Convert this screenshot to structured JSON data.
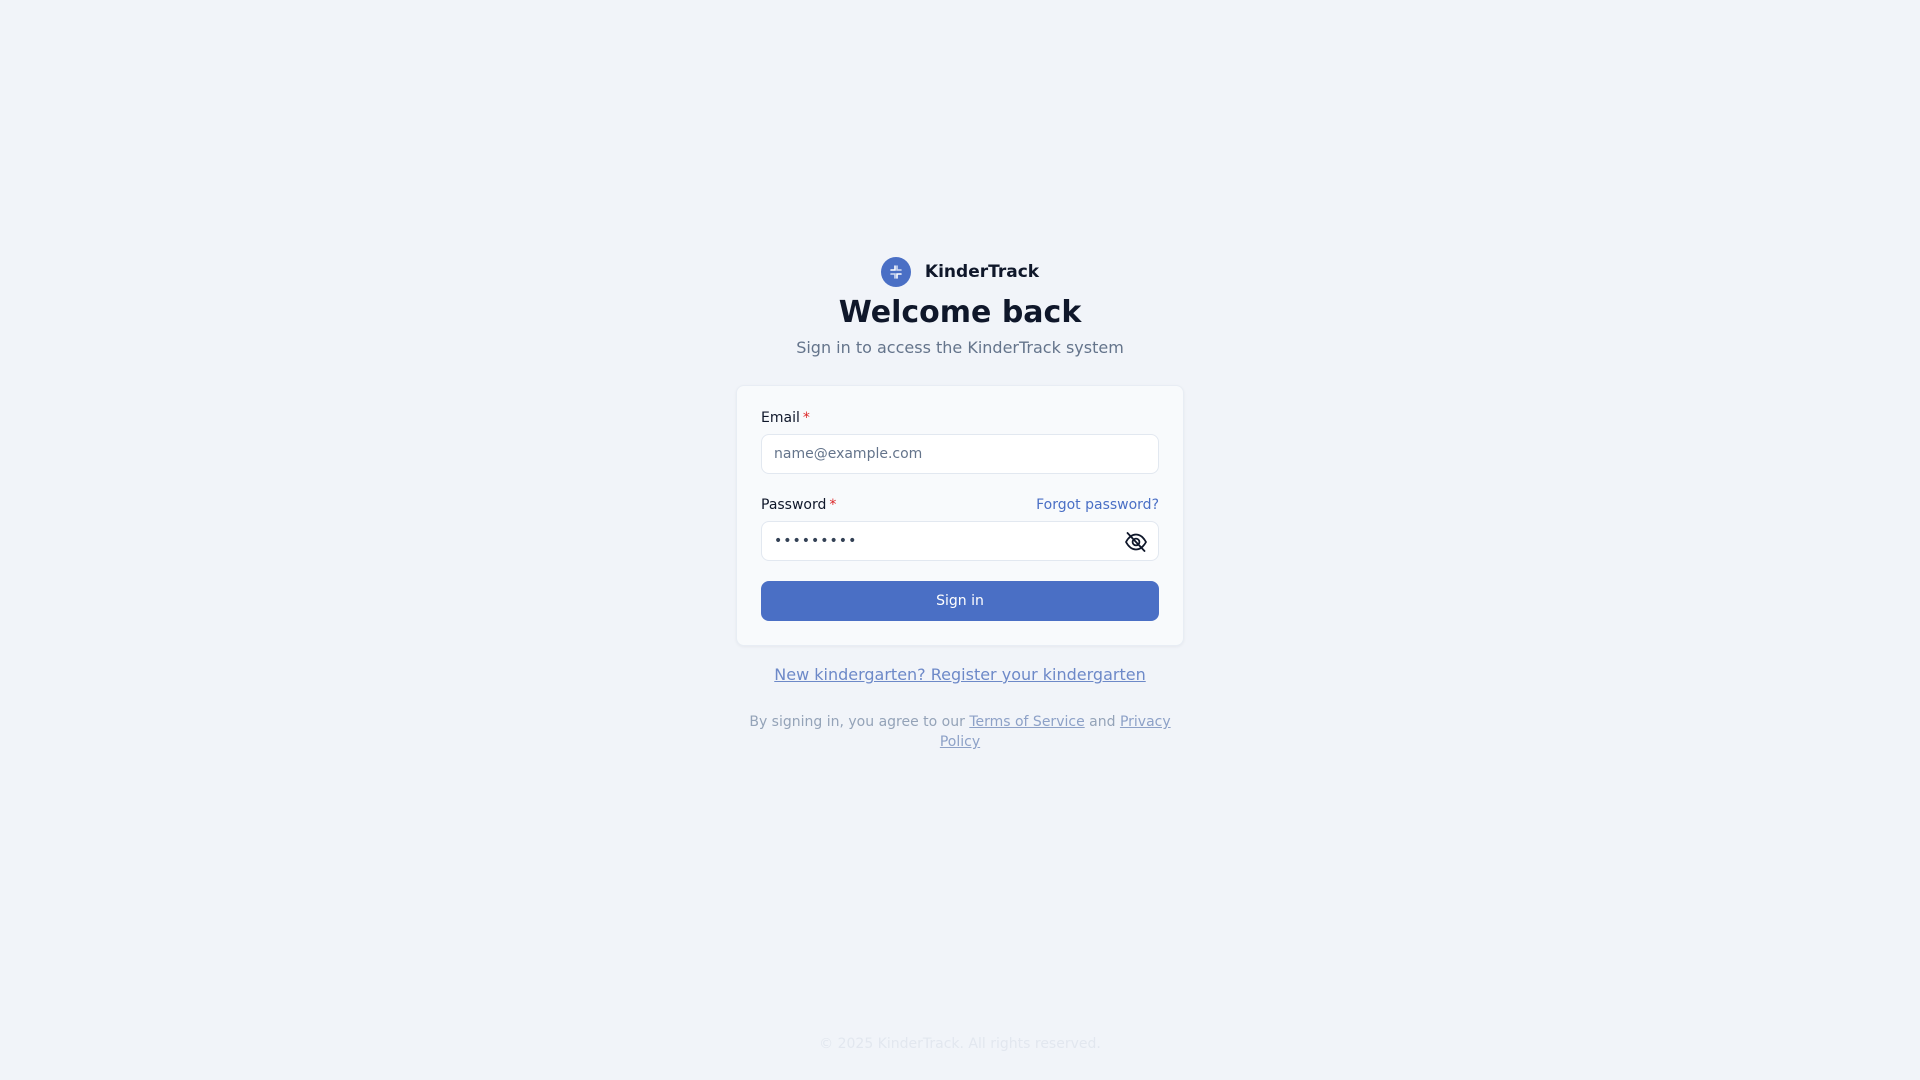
{
  "brand": {
    "logo_icon": "compass-icon",
    "name": "KinderTrack"
  },
  "header": {
    "title": "Welcome back",
    "subtitle": "Sign in to access the KinderTrack system"
  },
  "form": {
    "email": {
      "label": "Email",
      "required_mark": "*",
      "value": "",
      "placeholder": "name@example.com"
    },
    "password": {
      "label": "Password",
      "required_mark": "*",
      "masked_value": "•••••••••",
      "toggle_icon": "eye-off-icon",
      "forgot_link": "Forgot password?"
    },
    "submit_label": "Sign in"
  },
  "register_link": "New kindergarten? Register your kindergarten",
  "legal": {
    "prefix": "By signing in, you agree to our",
    "terms": "Terms of Service",
    "conjunction": "and",
    "privacy": "Privacy Policy"
  },
  "footer": {
    "copyright": "© 2025 KinderTrack. All rights reserved."
  },
  "colors": {
    "background": "#f1f4f9",
    "accent": "#4a6fc5",
    "required": "#dc2626",
    "muted_text": "#64748b"
  }
}
